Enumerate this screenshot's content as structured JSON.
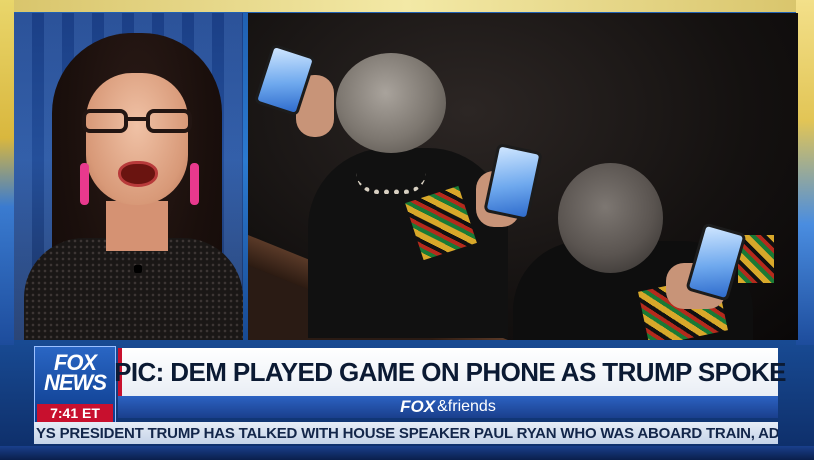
{
  "broadcast": {
    "logo_top": "FOX",
    "logo_bottom": "NEWS",
    "time": "7:41 ET",
    "headline": "PIC: DEM PLAYED GAME ON PHONE AS TRUMP SPOKE",
    "show_name_bold": "FOX",
    "show_name_rest": "&friends",
    "ticker": "YS PRESIDENT TRUMP HAS TALKED WITH HOUSE SPEAKER PAUL RYAN WHO WAS ABOARD TRAIN, ADDING"
  },
  "colors": {
    "fox_red": "#c8102e",
    "fox_blue": "#1a3f8c",
    "headline_text": "#0b1a33"
  }
}
